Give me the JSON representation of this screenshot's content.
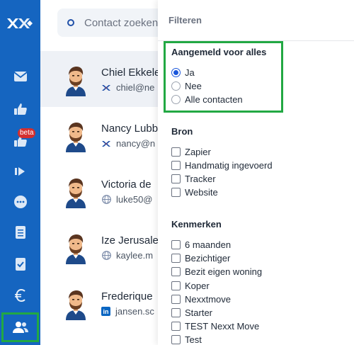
{
  "colors": {
    "sidebar": "#1565c0",
    "highlight": "#22a843",
    "accent": "#1a56db",
    "badge": "#d32f2f"
  },
  "sidebar": {
    "items": [
      {
        "icon": "mail-icon"
      },
      {
        "icon": "thumbs-up-icon"
      },
      {
        "icon": "thumbs-up-beta-icon",
        "badge": "beta"
      },
      {
        "icon": "fast-forward-icon"
      },
      {
        "icon": "chat-bubble-icon"
      },
      {
        "icon": "list-document-icon"
      },
      {
        "icon": "checklist-icon"
      },
      {
        "icon": "euro-icon"
      },
      {
        "icon": "contacts-icon",
        "active": true
      }
    ]
  },
  "search": {
    "placeholder": "Contact zoeken..."
  },
  "contacts": [
    {
      "name": "Chiel Ekkele",
      "email": "chiel@ne",
      "source_icon": "nexxt-icon",
      "selected": true
    },
    {
      "name": "Nancy Lubb",
      "email": "nancy@n",
      "source_icon": "nexxt-icon"
    },
    {
      "name": "Victoria de",
      "email": "luke50@",
      "source_icon": "globe-icon"
    },
    {
      "name": "Ize Jerusale",
      "email": "kaylee.m",
      "source_icon": "globe-icon"
    },
    {
      "name": "Frederique",
      "email": "jansen.sc",
      "source_icon": "linkedin-icon"
    }
  ],
  "filter": {
    "title": "Filteren",
    "sections": [
      {
        "title": "Aangemeld voor alles",
        "type": "radio",
        "options": [
          "Ja",
          "Nee",
          "Alle contacten"
        ],
        "selected": "Ja"
      },
      {
        "title": "Bron",
        "type": "checkbox",
        "options": [
          "Zapier",
          "Handmatig ingevoerd",
          "Tracker",
          "Website"
        ]
      },
      {
        "title": "Kenmerken",
        "type": "checkbox",
        "options": [
          "6 maanden",
          "Bezichtiger",
          "Bezit eigen woning",
          "Koper",
          "Nexxtmove",
          "Starter",
          "TEST Nexxt Move",
          "Test"
        ]
      }
    ]
  }
}
